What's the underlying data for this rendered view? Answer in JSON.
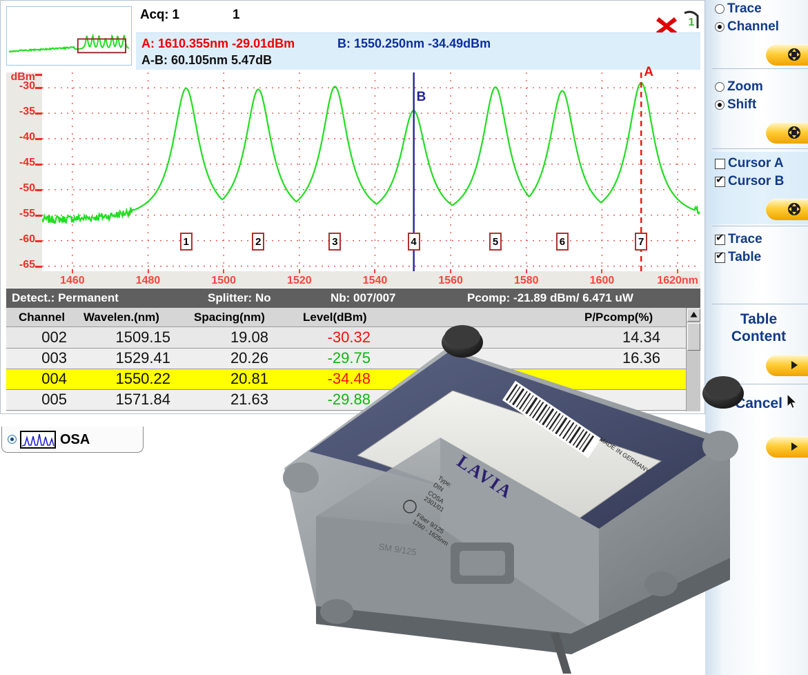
{
  "window": {
    "acq_label": "Acq: 1",
    "acq_number": "1",
    "close_icon": "close-x-icon",
    "trace_badge": "1"
  },
  "cursor_info": {
    "a": "A: 1610.355nm -29.01dBm",
    "b": "B: 1550.250nm -34.49dBm",
    "ab": "A-B: 60.105nm  5.47dB",
    "a_color": "#ee0000",
    "b_color": "#0b2f9e"
  },
  "chart_data": {
    "type": "line",
    "title": "",
    "xlabel": "nm",
    "ylabel": "dBm",
    "xlim": [
      1452,
      1626
    ],
    "ylim": [
      -66,
      -27
    ],
    "grid": true,
    "xticks": [
      1460,
      1480,
      1500,
      1520,
      1540,
      1560,
      1580,
      1600,
      1620
    ],
    "xtick_labels": [
      "1460",
      "1480",
      "1500",
      "1520",
      "1540",
      "1560",
      "1580",
      "1600",
      "1620nm"
    ],
    "yticks": [
      -30,
      -35,
      -40,
      -45,
      -50,
      -55,
      -60,
      -65
    ],
    "ytick_labels": [
      "-30",
      "-35",
      "-40",
      "-45",
      "-50",
      "-55",
      "-60",
      "-65"
    ],
    "series": [
      {
        "name": "Trace 1",
        "color": "#22dd22",
        "baseline_dbm": -56.2,
        "peaks": [
          {
            "index": 1,
            "wavelength": 1490.07,
            "level": -30.1
          },
          {
            "index": 2,
            "wavelength": 1509.15,
            "level": -30.32
          },
          {
            "index": 3,
            "wavelength": 1529.41,
            "level": -29.75
          },
          {
            "index": 4,
            "wavelength": 1550.22,
            "level": -34.48
          },
          {
            "index": 5,
            "wavelength": 1571.84,
            "level": -29.88
          },
          {
            "index": 6,
            "wavelength": 1589.5,
            "level": -30.6
          },
          {
            "index": 7,
            "wavelength": 1610.355,
            "level": -29.01
          }
        ]
      }
    ],
    "peak_markers": [
      "1",
      "2",
      "3",
      "4",
      "5",
      "6",
      "7"
    ],
    "cursors": [
      {
        "name": "A",
        "label": "A",
        "wavelength": 1610.355,
        "level": -29.01,
        "color": "#ee1111",
        "style": "dashed"
      },
      {
        "name": "B",
        "label": "B",
        "wavelength": 1550.25,
        "level": -34.49,
        "color": "#23239c",
        "style": "solid"
      }
    ]
  },
  "status": {
    "detect": "Detect.: Permanent",
    "splitter": "Splitter: No",
    "nb": "Nb: 007/007",
    "pcomp": "Pcomp:   -21.89 dBm/ 6.471 uW"
  },
  "table": {
    "headers": {
      "channel": "Channel",
      "wavelength": "Wavelen.(nm)",
      "spacing": "Spacing(nm)",
      "level": "Level(dBm)",
      "ppcomp": "P/Pcomp(%)"
    },
    "rows": [
      {
        "channel": "002",
        "wavelength": "1509.15",
        "spacing": "19.08",
        "level": "-30.32",
        "level_color": "red",
        "ppcomp": "14.34",
        "selected": false
      },
      {
        "channel": "003",
        "wavelength": "1529.41",
        "spacing": "20.26",
        "level": "-29.75",
        "level_color": "green",
        "ppcomp": "16.36",
        "selected": false
      },
      {
        "channel": "004",
        "wavelength": "1550.22",
        "spacing": "20.81",
        "level": "-34.48",
        "level_color": "red",
        "ppcomp": "",
        "selected": true
      },
      {
        "channel": "005",
        "wavelength": "1571.84",
        "spacing": "21.63",
        "level": "-29.88",
        "level_color": "green",
        "ppcomp": "",
        "selected": false
      }
    ]
  },
  "taskbar": {
    "osa_label": "OSA",
    "osa_icon": "spectrum-icon"
  },
  "sidebar": {
    "panel1": {
      "options": [
        {
          "label": "Trace",
          "selected": false
        },
        {
          "label": "Channel",
          "selected": true
        }
      ],
      "nav_icon": "four-way-arrow-icon"
    },
    "panel2": {
      "options": [
        {
          "label": "Zoom",
          "selected": false
        },
        {
          "label": "Shift",
          "selected": true
        }
      ],
      "nav_icon": "four-way-arrow-icon"
    },
    "panel3": {
      "options": [
        {
          "label": "Cursor A",
          "checked": false
        },
        {
          "label": "Cursor B",
          "checked": true
        }
      ],
      "nav_icon": "four-way-arrow-icon"
    },
    "panel4": {
      "options": [
        {
          "label": "Trace",
          "checked": true
        },
        {
          "label": "Table",
          "checked": true
        }
      ]
    },
    "panel5": {
      "title_line1": "Table",
      "title_line2": "Content",
      "nav_icon": "right-arrow-icon"
    },
    "panel6": {
      "title_line1": "Cancel",
      "nav_icon": "right-arrow-icon"
    }
  },
  "colors": {
    "trace_green": "#22dd22",
    "axis_red": "#e8312a",
    "cursor_blue": "#23239c",
    "select_yellow": "#ffff00",
    "sidebar_text": "#123a86",
    "status_bg": "#5f5f5f"
  }
}
